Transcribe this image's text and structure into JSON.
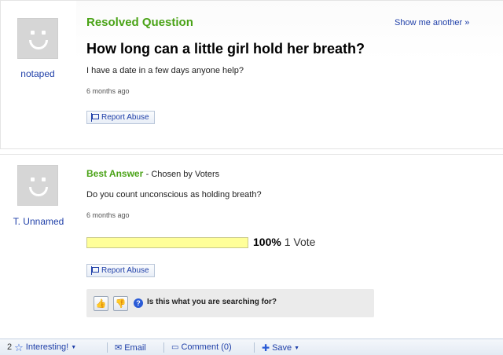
{
  "question": {
    "header": "Resolved Question",
    "show_another": "Show me another »",
    "title": "How long can a little girl hold her breath?",
    "body": "I have a date in a few days anyone help?",
    "time": "6 months ago",
    "report_label": "Report Abuse",
    "asker": "notaped"
  },
  "answer": {
    "header": "Best Answer",
    "chosen_by": "- Chosen by Voters",
    "body": "Do you count unconscious as holding breath?",
    "time": "6 months ago",
    "answerer": "T. Unnamed",
    "vote_percent": "100%",
    "vote_fraction": 1.0,
    "vote_count": "1 Vote",
    "report_label": "Report Abuse",
    "search_prompt": "Is this what you are searching for?"
  },
  "bottom_bar": {
    "interesting_count": "2",
    "interesting_label": "Interesting!",
    "email_label": "Email",
    "comment_label": "Comment (0)",
    "save_label": "Save"
  },
  "colors": {
    "accent_green": "#4aa317",
    "link_blue": "#1f3fa8",
    "avatar_gray": "#d6d6d6",
    "vote_bar_yellow": "#ffff99"
  }
}
